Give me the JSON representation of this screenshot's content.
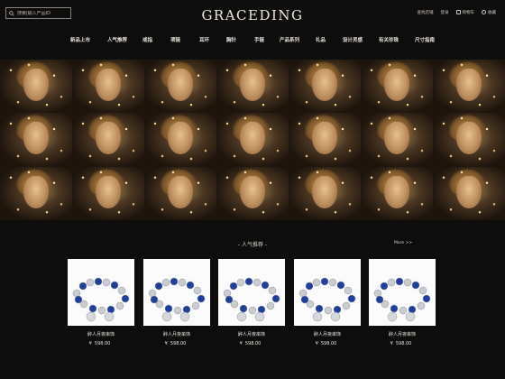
{
  "header": {
    "search_placeholder": "搜索|输入产品ID",
    "logo": "GRACEDING",
    "util": [
      {
        "label": "查找店铺",
        "icon": "none"
      },
      {
        "label": "登录",
        "icon": "none"
      },
      {
        "label": "购物车",
        "icon": "cart-icon"
      },
      {
        "label": "收藏",
        "icon": "heart-icon"
      }
    ]
  },
  "nav": [
    "新品上市",
    "人气推荐",
    "戒指",
    "项链",
    "耳环",
    "胸针",
    "手链",
    "产品系列",
    "礼品",
    "设计灵感",
    "有关珍珠",
    "尺寸指南"
  ],
  "section": {
    "title": "- 人气推荐 -",
    "more": "More >>"
  },
  "products": [
    {
      "name": "醉人月夜串饰",
      "currency": "¥",
      "price": "598.00"
    },
    {
      "name": "醉人月夜串饰",
      "currency": "¥",
      "price": "598.00"
    },
    {
      "name": "醉人月夜串饰",
      "currency": "¥",
      "price": "598.00"
    },
    {
      "name": "醉人月夜串饰",
      "currency": "¥",
      "price": "598.00"
    },
    {
      "name": "醉人月夜串饰",
      "currency": "¥",
      "price": "598.00"
    }
  ],
  "colors": {
    "background": "#0d0d0d",
    "text": "#e8e1d8",
    "bead_blue": "#1f3f9a"
  }
}
